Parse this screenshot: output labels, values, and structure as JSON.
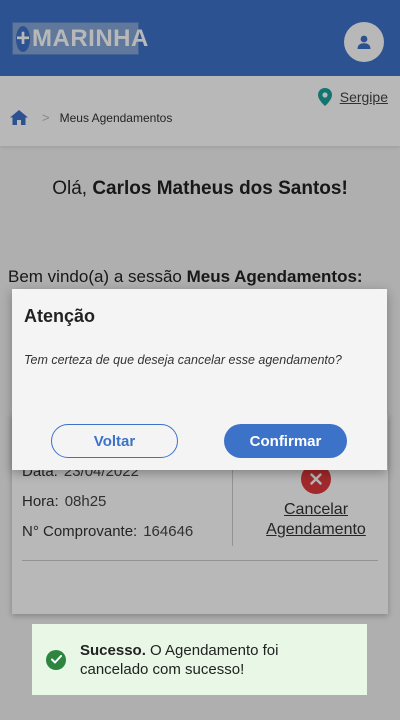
{
  "header": {
    "logo_plus": "+",
    "logo_text": "MARINHA"
  },
  "location": {
    "label": "Sergipe"
  },
  "breadcrumb": {
    "separator": ">",
    "current": "Meus Agendamentos"
  },
  "greeting": {
    "prefix": "Olá, ",
    "name": "Carlos Matheus dos Santos!"
  },
  "welcome": {
    "prefix": "Bem vindo(a) a sessão ",
    "section": "Meus Agendamentos:"
  },
  "appointment": {
    "date_label": "Data:",
    "date_value": "23/04/2022",
    "time_label": "Hora:",
    "time_value": "08h25",
    "receipt_label": "N° Comprovante:",
    "receipt_value": "164646",
    "cancel_line1": "Cancelar",
    "cancel_line2": "Agendamento"
  },
  "modal": {
    "title": "Atenção",
    "message": "Tem certeza de que deseja cancelar esse agendamento?",
    "back_label": "Voltar",
    "confirm_label": "Confirmar"
  },
  "toast": {
    "title": "Sucesso.",
    "message_line1": " O Agendamento foi",
    "message_line2": "cancelado com sucesso!"
  },
  "colors": {
    "primary": "#3d72c9",
    "danger": "#e0393e",
    "success": "#2e8540",
    "location_pin": "#1aa39a"
  }
}
